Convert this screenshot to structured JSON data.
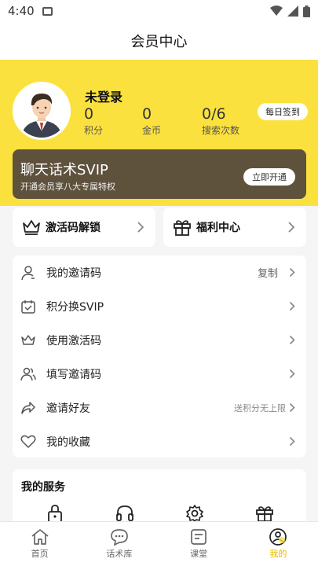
{
  "status_bar": {
    "time": "4:40"
  },
  "header": {
    "title": "会员中心"
  },
  "profile": {
    "name": "未登录",
    "checkin_label": "每日签到",
    "stats": [
      {
        "value": "0",
        "label": "积分"
      },
      {
        "value": "0",
        "label": "金币"
      },
      {
        "value": "0/6",
        "label": "搜索次数"
      }
    ]
  },
  "svip": {
    "title": "聊天话术SVIP",
    "subtitle": "开通会员享八大专属特权",
    "button": "立即开通"
  },
  "quick_cards": [
    {
      "label": "激活码解锁",
      "icon": "crown-icon"
    },
    {
      "label": "福利中心",
      "icon": "gift-icon"
    }
  ],
  "menu": [
    {
      "label": "我的邀请码",
      "right": "复制",
      "icon": "user-icon"
    },
    {
      "label": "积分换SVIP",
      "right": "",
      "icon": "calendar-check-icon"
    },
    {
      "label": "使用激活码",
      "right": "",
      "icon": "crown-icon"
    },
    {
      "label": "填写邀请码",
      "right": "",
      "icon": "users-icon"
    },
    {
      "label": "邀请好友",
      "right": "送积分无上限",
      "icon": "share-icon"
    },
    {
      "label": "我的收藏",
      "right": "",
      "icon": "heart-icon"
    }
  ],
  "services": {
    "title": "我的服务",
    "icons": [
      "lock-icon",
      "headset-icon",
      "settings-icon",
      "gift-icon"
    ]
  },
  "tabbar": [
    {
      "label": "首页",
      "icon": "home-icon",
      "active": false
    },
    {
      "label": "话术库",
      "icon": "chat-icon",
      "active": false
    },
    {
      "label": "课堂",
      "icon": "book-icon",
      "active": false
    },
    {
      "label": "我的",
      "icon": "profile-icon",
      "active": true
    }
  ],
  "colors": {
    "accent_yellow": "#fbe13d",
    "svip_brown": "#5f523d",
    "active_tab": "#e9b800"
  }
}
